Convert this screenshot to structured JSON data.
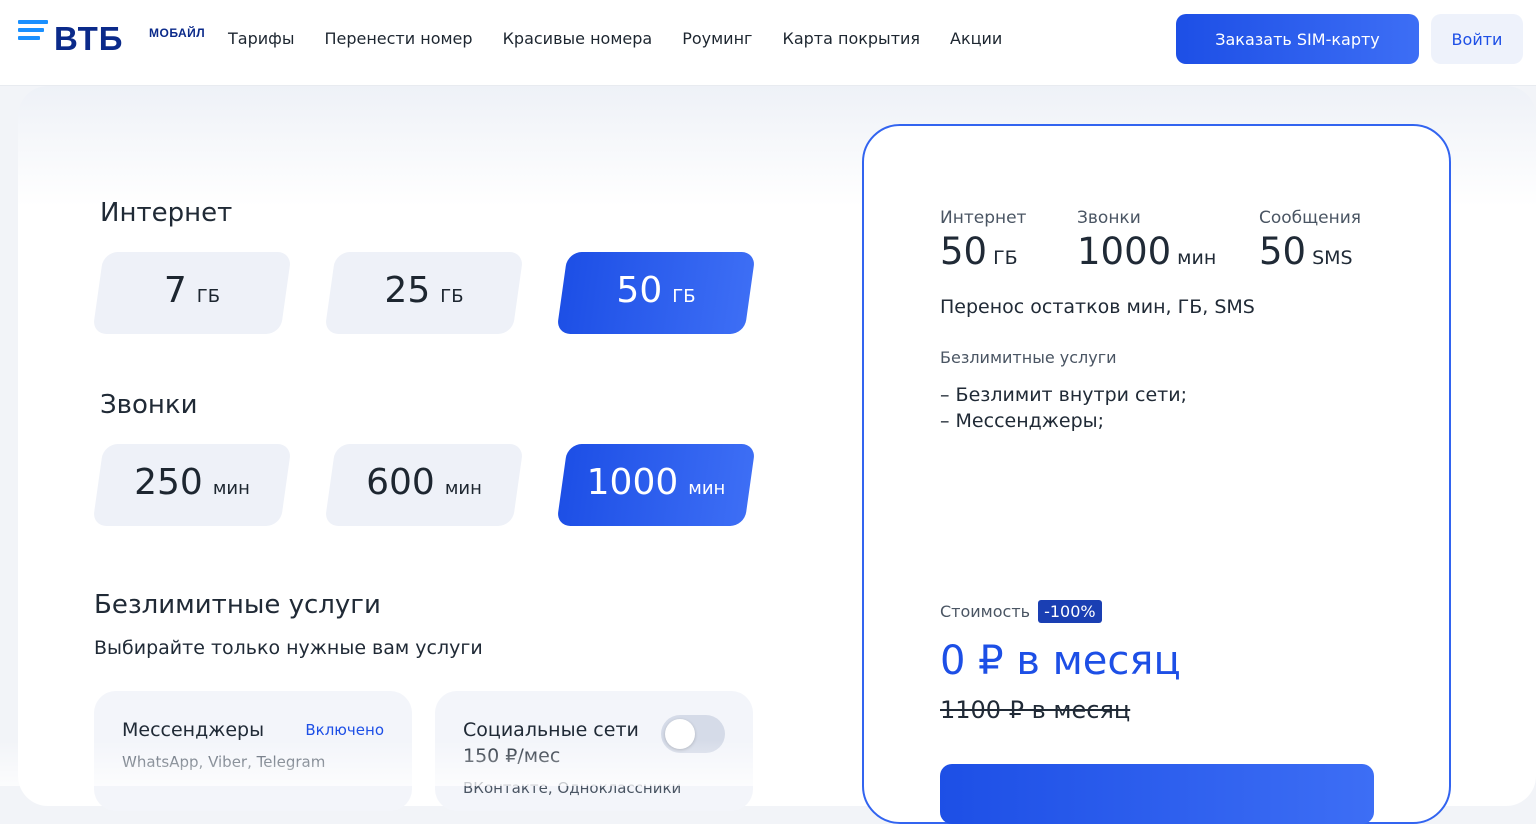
{
  "header": {
    "logo_brand": "ВТБ",
    "logo_sub": "МОБАЙЛ",
    "nav": [
      "Тарифы",
      "Перенести номер",
      "Красивые номера",
      "Роуминг",
      "Карта покрытия",
      "Акции"
    ],
    "order_sim": "Заказать SIM-карту",
    "login": "Войти"
  },
  "internet": {
    "title": "Интернет",
    "options": [
      {
        "value": "7",
        "unit": "ГБ"
      },
      {
        "value": "25",
        "unit": "ГБ"
      },
      {
        "value": "50",
        "unit": "ГБ"
      }
    ],
    "selected_index": 2
  },
  "calls": {
    "title": "Звонки",
    "options": [
      {
        "value": "250",
        "unit": "мин"
      },
      {
        "value": "600",
        "unit": "мин"
      },
      {
        "value": "1000",
        "unit": "мин"
      }
    ],
    "selected_index": 2
  },
  "unlimited": {
    "title": "Безлимитные услуги",
    "subtitle": "Выбирайте только нужные вам услуги",
    "cards": [
      {
        "title": "Мессенджеры",
        "status": "Включено",
        "desc": "WhatsApp, Viber, Telegram"
      },
      {
        "title": "Социальные сети",
        "price": "150 ₽/мес",
        "desc": "ВКонтакте, Одноклассники",
        "enabled": false
      }
    ]
  },
  "summary": {
    "internet_label": "Интернет",
    "internet_value": "50",
    "internet_unit": "ГБ",
    "calls_label": "Звонки",
    "calls_value": "1000",
    "calls_unit": "мин",
    "sms_label": "Сообщения",
    "sms_value": "50",
    "sms_unit": "SMS",
    "transfer": "Перенос остатков мин, ГБ, SMS",
    "unlimited_label": "Безлимитные услуги",
    "unlimited_items": [
      "– Безлимит внутри сети;",
      "– Мессенджеры;"
    ],
    "cost_label": "Стоимость",
    "discount": "-100%",
    "price": "0 ₽ в месяц",
    "old_price": "1100 ₽ в месяц"
  },
  "colors": {
    "accent": "#1d4fe6",
    "badge": "#1a3fb3"
  }
}
